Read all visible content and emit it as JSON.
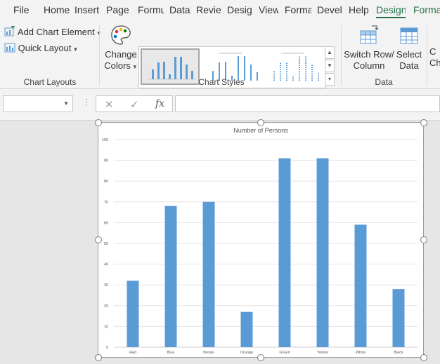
{
  "tabs": [
    "File",
    "Home",
    "Insert",
    "Page L",
    "Formu",
    "Data",
    "Review",
    "Design",
    "View",
    "Forma",
    "Develo",
    "Help",
    "Design",
    "Format"
  ],
  "active_tab": "Design",
  "ribbon": {
    "add_chart_element": "Add Chart Element",
    "quick_layout": "Quick Layout",
    "change_colors_1": "Change",
    "change_colors_2": "Colors",
    "switch_row_1": "Switch Row/",
    "switch_row_2": "Column",
    "select_data_1": "Select",
    "select_data_2": "Data",
    "partial_next_1": "C",
    "partial_next_2": "Ch",
    "group_chart_layouts": "Chart Layouts",
    "group_chart_styles": "Chart Styles",
    "group_data": "Data"
  },
  "formula_bar": {
    "name_box": "",
    "formula": "",
    "fx": "fx"
  },
  "colors": {
    "accent": "#217346",
    "bar": "#5b9bd5"
  },
  "chart_data": {
    "type": "bar",
    "title": "Number of Persons",
    "categories": [
      "Red",
      "Blue",
      "Brown",
      "Orange",
      "Green",
      "Yellow",
      "White",
      "Black"
    ],
    "values": [
      32,
      68,
      70,
      17,
      91,
      91,
      59,
      28
    ],
    "ylim": [
      0,
      100
    ],
    "yticks": [
      "0",
      "10",
      "20",
      "30",
      "40",
      "50",
      "60",
      "70",
      "80",
      "90",
      "100"
    ],
    "grid": true,
    "xlabel": "",
    "ylabel": ""
  }
}
